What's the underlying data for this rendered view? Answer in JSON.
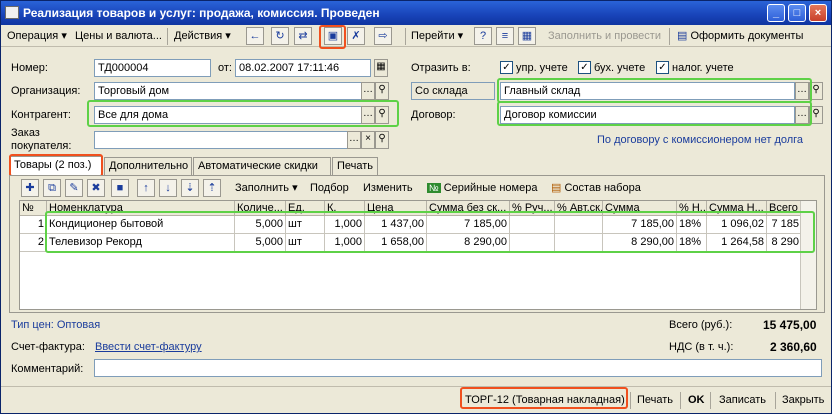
{
  "window": {
    "title": "Реализация товаров и услуг: продажа, комиссия. Проведен",
    "btn_min": "_",
    "btn_max": "□",
    "btn_close": "×"
  },
  "toolbar": {
    "operation": "Операция",
    "prices": "Цены и валюта...",
    "actions": "Действия",
    "goto": "Перейти",
    "help": "?",
    "fill_post": "Заполнить и провести",
    "make_docs": "Оформить документы"
  },
  "header": {
    "number_label": "Номер:",
    "number_value": "ТД000004",
    "from_label": "от:",
    "date_value": "08.02.2007 17:11:46",
    "reflect_label": "Отразить в:",
    "chk_mgmt": "упр. учете",
    "chk_acc": "бух. учете",
    "chk_tax": "налог. учете",
    "org_label": "Организация:",
    "org_value": "Торговый дом",
    "warehouse_mode": "Со склада",
    "warehouse_value": "Главный склад",
    "counterparty_label": "Контрагент:",
    "counterparty_value": "Все для дома",
    "contract_label": "Договор:",
    "contract_value": "Договор комиссии",
    "order_label_1": "Заказ",
    "order_label_2": "покупателя:",
    "order_value": "",
    "commission_debt_link": "По договору с комиссионером нет долга"
  },
  "tabs": [
    "Товары (2 поз.)",
    "Дополнительно",
    "Автоматические скидки",
    "Печать"
  ],
  "table_toolbar": {
    "fill": "Заполнить",
    "select": "Подбор",
    "change": "Изменить",
    "serials": "Серийные номера",
    "kit": "Состав набора"
  },
  "table": {
    "columns": [
      "№",
      "Номенклатура",
      "Количе...",
      "Ед.",
      "К.",
      "Цена",
      "Сумма без ск...",
      "% Руч...",
      "% Авт.ск...",
      "Сумма",
      "% Н...",
      "Сумма Н...",
      "Всего"
    ],
    "rows": [
      [
        "1",
        "Кондиционер бытовой",
        "5,000",
        "шт",
        "1,000",
        "1 437,00",
        "7 185,00",
        "",
        "",
        "7 185,00",
        "18%",
        "1 096,02",
        "7 185"
      ],
      [
        "2",
        "Телевизор Рекорд",
        "5,000",
        "шт",
        "1,000",
        "1 658,00",
        "8 290,00",
        "",
        "",
        "8 290,00",
        "18%",
        "1 264,58",
        "8 290"
      ]
    ]
  },
  "footer": {
    "price_type": "Тип цен: Оптовая",
    "total_label": "Всего (руб.):",
    "total_value": "15 475,00",
    "invoice_label": "Счет-фактура:",
    "invoice_link": "Ввести счет-фактуру",
    "vat_label": "НДС (в т. ч.):",
    "vat_value": "2 360,60",
    "comment_label": "Комментарий:",
    "comment_value": ""
  },
  "bottom": {
    "torg12": "ТОРГ-12 (Товарная накладная)",
    "print": "Печать",
    "ok": "OK",
    "save": "Записать",
    "close": "Закрыть"
  },
  "colors": {
    "highlight_green": "#5ed147",
    "highlight_red": "#f0501e",
    "title_blue": "#1843b8",
    "link_blue": "#1a3c9c"
  }
}
